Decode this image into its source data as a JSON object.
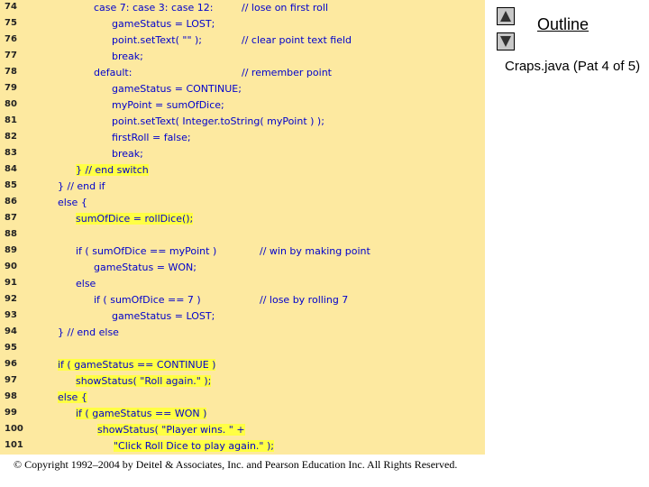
{
  "code": {
    "lines": [
      {
        "num": "74",
        "code": "case 7: case 3: case 12:",
        "comment": "// lose on first roll"
      },
      {
        "num": "75",
        "code": "gameStatus = LOST;",
        "comment": ""
      },
      {
        "num": "76",
        "code": "point.setText( \"\" );",
        "comment": "// clear point text field"
      },
      {
        "num": "77",
        "code": "break;",
        "comment": ""
      },
      {
        "num": "78",
        "code": "default:",
        "comment": "// remember point"
      },
      {
        "num": "79",
        "code": "gameStatus = CONTINUE;",
        "comment": ""
      },
      {
        "num": "80",
        "code": "myPoint = sumOfDice;",
        "comment": ""
      },
      {
        "num": "81",
        "code": "point.setText( Integer.toString( myPoint ) );",
        "comment": ""
      },
      {
        "num": "82",
        "code": "firstRoll = false;",
        "comment": ""
      },
      {
        "num": "83",
        "code": "break;",
        "comment": ""
      },
      {
        "num": "84",
        "code": "} // end switch",
        "comment": ""
      },
      {
        "num": "85",
        "code": "} // end if",
        "comment": ""
      },
      {
        "num": "86",
        "code": "else {",
        "comment": ""
      },
      {
        "num": "87",
        "code": "sumOfDice = rollDice();",
        "comment": ""
      },
      {
        "num": "88",
        "code": "",
        "comment": ""
      },
      {
        "num": "89",
        "code": "if ( sumOfDice == myPoint )",
        "comment": "// win by making point"
      },
      {
        "num": "90",
        "code": "gameStatus = WON;",
        "comment": ""
      },
      {
        "num": "91",
        "code": "else",
        "comment": ""
      },
      {
        "num": "92",
        "code": "if ( sumOfDice == 7 )",
        "comment": "// lose by rolling 7"
      },
      {
        "num": "93",
        "code": "gameStatus = LOST;",
        "comment": ""
      },
      {
        "num": "94",
        "code": "} // end else",
        "comment": ""
      },
      {
        "num": "95",
        "code": "",
        "comment": ""
      },
      {
        "num": "96",
        "code": "if ( gameStatus == CONTINUE )",
        "comment": ""
      },
      {
        "num": "97",
        "code": "showStatus( \"Roll again.\" );",
        "comment": ""
      },
      {
        "num": "98",
        "code": "else {",
        "comment": ""
      },
      {
        "num": "99",
        "code": "if ( gameStatus == WON )",
        "comment": ""
      },
      {
        "num": "100",
        "code": "showStatus( \"Player wins. \" +",
        "comment": ""
      },
      {
        "num": "101",
        "code": "\"Click Roll Dice to play again.\" );",
        "comment": ""
      }
    ]
  },
  "sidebar": {
    "outline_label": "Outline",
    "subtitle": "Craps.java (Pat 4 of 5)",
    "prev_icon": "triangle-up-icon",
    "next_icon": "triangle-down-icon"
  },
  "footer": {
    "copyright": "© Copyright 1992–2004 by Deitel & Associates, Inc. and Pearson Education Inc. All Rights Reserved."
  },
  "colors": {
    "panel_bg": "#fde9a0",
    "highlight": "#ffff44",
    "code_text": "#0000cc"
  }
}
